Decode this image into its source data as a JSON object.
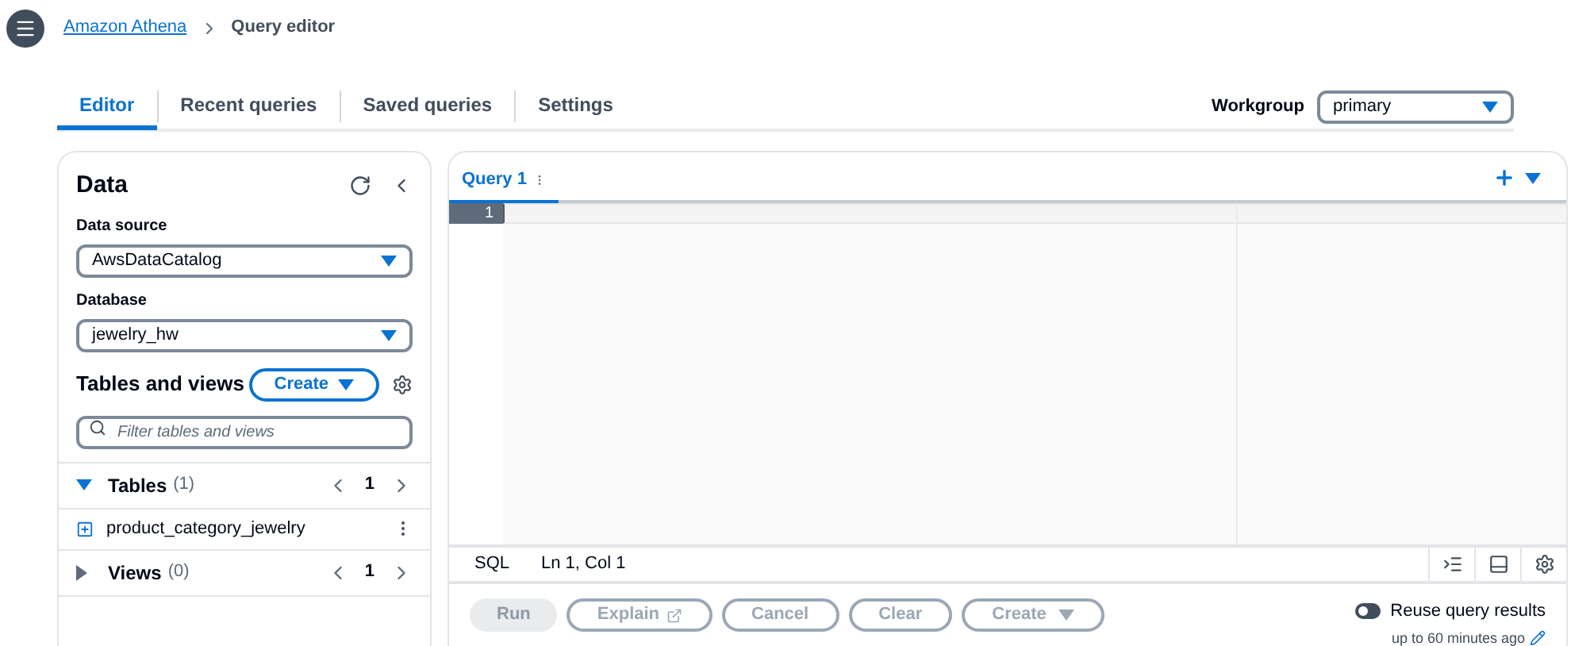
{
  "breadcrumb": {
    "link": "Amazon Athena",
    "current": "Query editor"
  },
  "tabs": [
    {
      "label": "Editor",
      "selected": true
    },
    {
      "label": "Recent queries",
      "selected": false
    },
    {
      "label": "Saved queries",
      "selected": false
    },
    {
      "label": "Settings",
      "selected": false
    }
  ],
  "workgroup": {
    "label": "Workgroup",
    "value": "primary"
  },
  "data_panel": {
    "title": "Data",
    "data_source": {
      "label": "Data source",
      "value": "AwsDataCatalog"
    },
    "database": {
      "label": "Database",
      "value": "jewelry_hw"
    },
    "tables_and_views": {
      "title": "Tables and views",
      "create_button": "Create",
      "filter": {
        "placeholder": "Filter tables and views"
      },
      "sections": [
        {
          "name": "Tables",
          "count": "(1)",
          "expanded": true,
          "page": "1",
          "items": [
            "product_category_jewelry"
          ]
        },
        {
          "name": "Views",
          "count": "(0)",
          "expanded": false,
          "page": "1"
        }
      ]
    }
  },
  "editor": {
    "tabs": [
      {
        "label": "Query 1",
        "selected": true
      }
    ],
    "line_numbers": [
      "1"
    ],
    "status": {
      "language": "SQL",
      "position": "Ln 1, Col 1"
    },
    "buttons": [
      {
        "label": "Run",
        "kind": "primary",
        "disabled": true
      },
      {
        "label": "Explain",
        "kind": "external",
        "disabled": true
      },
      {
        "label": "Cancel",
        "kind": "plain",
        "disabled": true
      },
      {
        "label": "Clear",
        "kind": "plain",
        "disabled": true
      },
      {
        "label": "Create",
        "kind": "dropdown",
        "disabled": true
      }
    ],
    "reuse": {
      "label": "Reuse query results",
      "on": false,
      "detail": "up to 60 minutes ago"
    }
  }
}
